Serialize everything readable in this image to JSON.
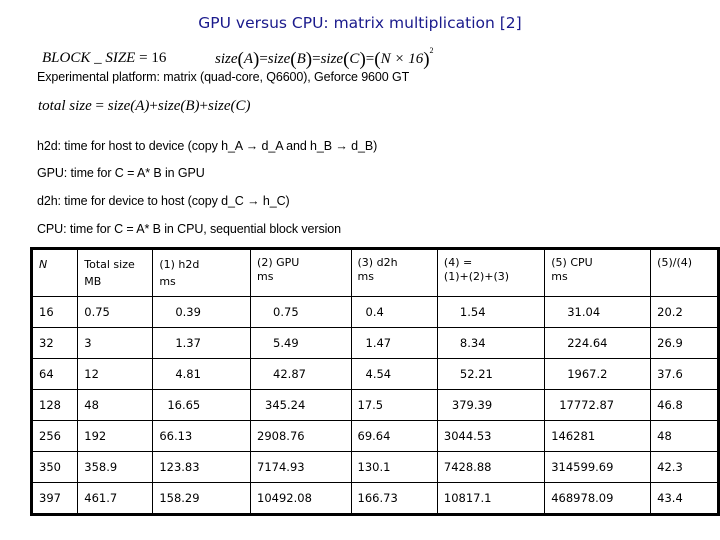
{
  "title": "GPU versus CPU: matrix multiplication [2]",
  "formulas": {
    "block_size": {
      "lhs": "BLOCK _ SIZE",
      "eq": "=",
      "value": "16"
    },
    "matrix_size": {
      "a": "size",
      "A": "A",
      "B": "B",
      "C": "C",
      "rhs_base": "N × 16",
      "exponent": "2"
    },
    "total_size": {
      "lhs": "total size",
      "terms": [
        "size(A)",
        "size(B)",
        "size(C)"
      ]
    }
  },
  "lines": [
    "Experimental platform: matrix (quad-core, Q6600), Geforce 9600 GT",
    "h2d: time for host to device (copy h_A → d_A and h_B → d_B)",
    "GPU: time for C = A* B in GPU",
    "d2h: time for device to host (copy d_C → h_C)",
    "CPU: time for C = A* B in CPU, sequential block version"
  ],
  "table": {
    "headers": [
      [
        "N",
        ""
      ],
      [
        "Total size",
        "MB"
      ],
      [
        "(1) h2d",
        "ms"
      ],
      [
        "(2) GPU",
        "ms"
      ],
      [
        "(3) d2h",
        "ms"
      ],
      [
        "(4) =",
        "(1)+(2)+(3)"
      ],
      [
        "(5) CPU",
        "ms"
      ],
      [
        "(5)/(4)",
        ""
      ]
    ],
    "rows": [
      [
        "16",
        "0.75",
        "0.39",
        "0.75",
        "0.4",
        "1.54",
        "31.04",
        "20.2"
      ],
      [
        "32",
        "3",
        "1.37",
        "5.49",
        "1.47",
        "8.34",
        "224.64",
        "26.9"
      ],
      [
        "64",
        "12",
        "4.81",
        "42.87",
        "4.54",
        "52.21",
        "1967.2",
        "37.6"
      ],
      [
        "128",
        "48",
        "16.65",
        "345.24",
        "17.5",
        "379.39",
        "17772.87",
        "46.8"
      ],
      [
        "256",
        "192",
        "66.13",
        "2908.76",
        "69.64",
        "3044.53",
        "146281",
        "48"
      ],
      [
        "350",
        "358.9",
        "123.83",
        "7174.93",
        "130.1",
        "7428.88",
        "314599.69",
        "42.3"
      ],
      [
        "397",
        "461.7",
        "158.29",
        "10492.08",
        "166.73",
        "10817.1",
        "468978.09",
        "43.4"
      ]
    ]
  }
}
